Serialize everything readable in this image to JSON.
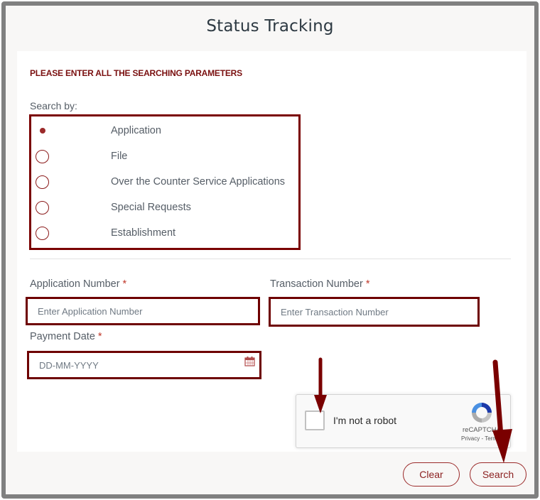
{
  "page": {
    "title": "Status Tracking",
    "heading": "PLEASE ENTER ALL THE SEARCHING PARAMETERS"
  },
  "search_by": {
    "label": "Search by:",
    "selected": "Application",
    "options": [
      {
        "label": "Application",
        "selected": true
      },
      {
        "label": "File",
        "selected": false
      },
      {
        "label": "Over the Counter Service Applications",
        "selected": false
      },
      {
        "label": "Special Requests",
        "selected": false
      },
      {
        "label": "Establishment",
        "selected": false
      }
    ]
  },
  "fields": {
    "application_number": {
      "label": "Application Number",
      "required_mark": "*",
      "placeholder": "Enter Application Number",
      "value": ""
    },
    "transaction_number": {
      "label": "Transaction Number",
      "required_mark": "*",
      "placeholder": "Enter Transaction Number",
      "value": ""
    },
    "payment_date": {
      "label": "Payment Date",
      "required_mark": "*",
      "placeholder": "DD-MM-YYYY",
      "value": "",
      "icon": "calendar-icon"
    }
  },
  "captcha": {
    "label": "I'm not a robot",
    "brand": "reCAPTCHA",
    "links": "Privacy - Terms",
    "checked": false
  },
  "buttons": {
    "clear": "Clear",
    "search": "Search"
  },
  "colors": {
    "accent": "#7a0000",
    "frame": "#808080",
    "background": "#f8f7f6"
  }
}
